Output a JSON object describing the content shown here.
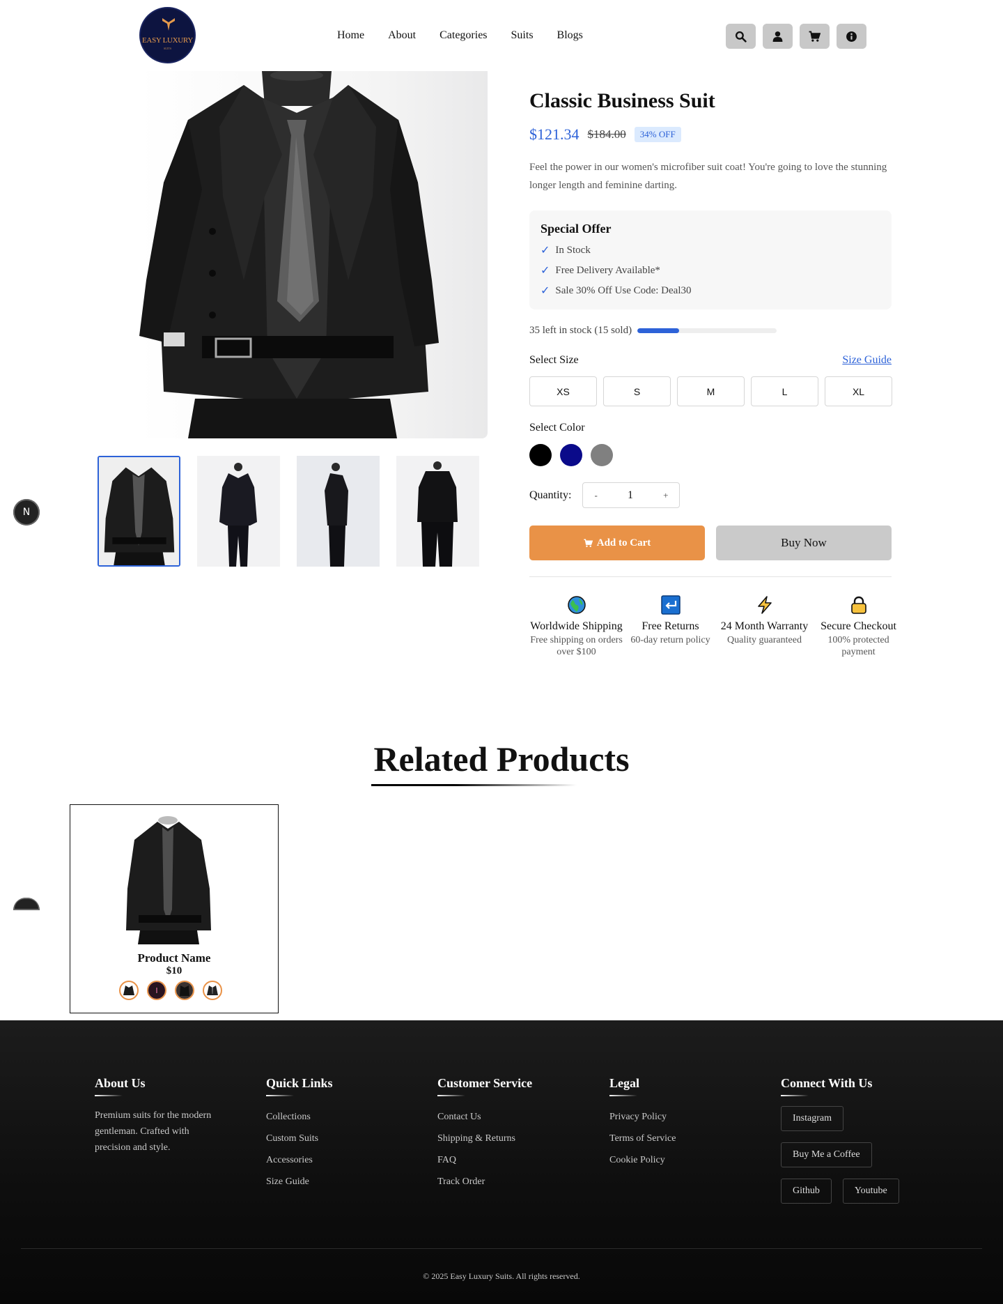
{
  "header": {
    "logo_text": "EASY LUXURY",
    "logo_subtext": "SUITS",
    "nav": [
      "Home",
      "About",
      "Categories",
      "Suits",
      "Blogs"
    ],
    "icons": [
      "search-icon",
      "user-icon",
      "cart-icon",
      "info-icon"
    ]
  },
  "product": {
    "title": "Classic Business Suit",
    "price": "$121.34",
    "old_price": "$184.00",
    "discount": "34% OFF",
    "description": "Feel the power in our women's microfiber suit coat! You're going to love the stunning longer length and feminine darting.",
    "offer": {
      "title": "Special Offer",
      "check_glyph": "✓",
      "items": [
        "In Stock",
        "Free Delivery Available*",
        "Sale 30% Off Use Code: Deal30"
      ]
    },
    "stock_text": "35 left in stock (15 sold)",
    "stock_progress": 0.3,
    "size_label": "Select Size",
    "size_guide": "Size Guide",
    "sizes": [
      "XS",
      "S",
      "M",
      "L",
      "XL"
    ],
    "color_label": "Select Color",
    "colors": [
      "#000000",
      "#0a0a8a",
      "#808080"
    ],
    "quantity_label": "Quantity:",
    "quantity_minus": "-",
    "quantity_value": "1",
    "quantity_plus": "+",
    "add_to_cart": "Add to Cart",
    "buy_now": "Buy Now",
    "features": [
      {
        "icon": "globe-icon",
        "title": "Worldwide Shipping",
        "sub": "Free shipping on orders over $100"
      },
      {
        "icon": "return-icon",
        "title": "Free Returns",
        "sub": "60-day return policy"
      },
      {
        "icon": "lightning-icon",
        "title": "24 Month Warranty",
        "sub": "Quality guaranteed"
      },
      {
        "icon": "lock-icon",
        "title": "Secure Checkout",
        "sub": "100% protected payment"
      }
    ]
  },
  "badge_letter": "N",
  "related": {
    "title": "Related Products",
    "card": {
      "name": "Product Name",
      "price": "$10"
    }
  },
  "footer": {
    "about": {
      "title": "About Us",
      "text": "Premium suits for the modern gentleman. Crafted with precision and style."
    },
    "quick_links": {
      "title": "Quick Links",
      "items": [
        "Collections",
        "Custom Suits",
        "Accessories",
        "Size Guide"
      ]
    },
    "customer_service": {
      "title": "Customer Service",
      "items": [
        "Contact Us",
        "Shipping & Returns",
        "FAQ",
        "Track Order"
      ]
    },
    "legal": {
      "title": "Legal",
      "items": [
        "Privacy Policy",
        "Terms of Service",
        "Cookie Policy"
      ]
    },
    "connect": {
      "title": "Connect With Us",
      "items": [
        "Instagram",
        "Buy Me a Coffee",
        "Github",
        "Youtube"
      ]
    },
    "copyright": "© 2025 Easy Luxury Suits. All rights reserved."
  }
}
